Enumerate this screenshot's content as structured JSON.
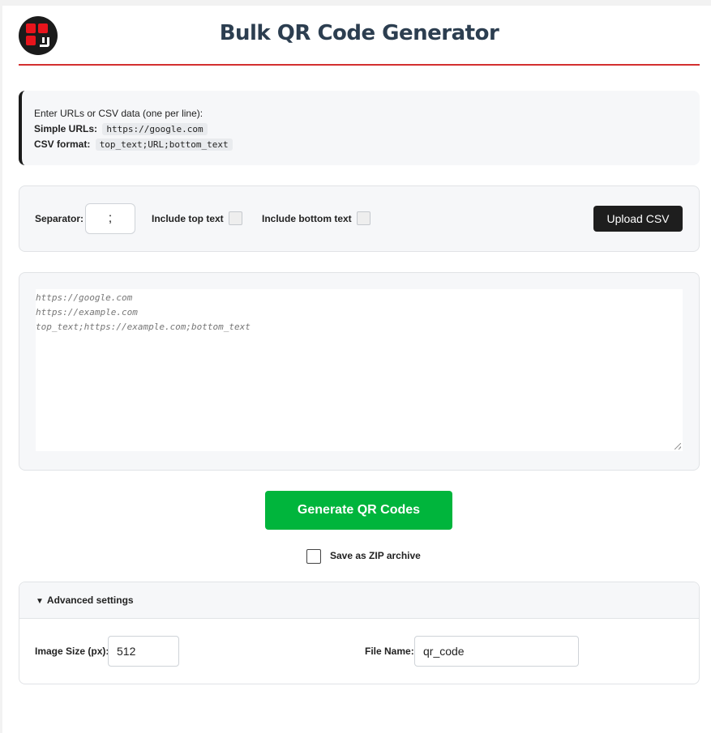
{
  "header": {
    "title": "Bulk QR Code Generator",
    "logo_icon": "qr-logo-icon",
    "accent_color": "#d32f2f"
  },
  "info": {
    "intro": "Enter URLs or CSV data (one per line):",
    "simple_label": "Simple URLs:",
    "simple_example": "https://google.com",
    "csv_label": "CSV format:",
    "csv_example": "top_text;URL;bottom_text"
  },
  "options": {
    "separator_label": "Separator:",
    "separator_value": ";",
    "top_text_label": "Include top text",
    "top_text_checked": false,
    "bottom_text_label": "Include bottom text",
    "bottom_text_checked": false,
    "upload_label": "Upload CSV"
  },
  "input": {
    "placeholder_lines": [
      "https://google.com",
      "https://example.com",
      "top_text;https://example.com;bottom_text"
    ]
  },
  "actions": {
    "generate_label": "Generate QR Codes",
    "generate_color": "#00b53c",
    "zip_label": "Save as ZIP archive",
    "zip_checked": false
  },
  "advanced": {
    "title": "Advanced settings",
    "caret_icon": "caret-down-icon",
    "size_label": "Image Size (px):",
    "size_value": "512",
    "filename_label": "File Name:",
    "filename_value": "qr_code"
  }
}
